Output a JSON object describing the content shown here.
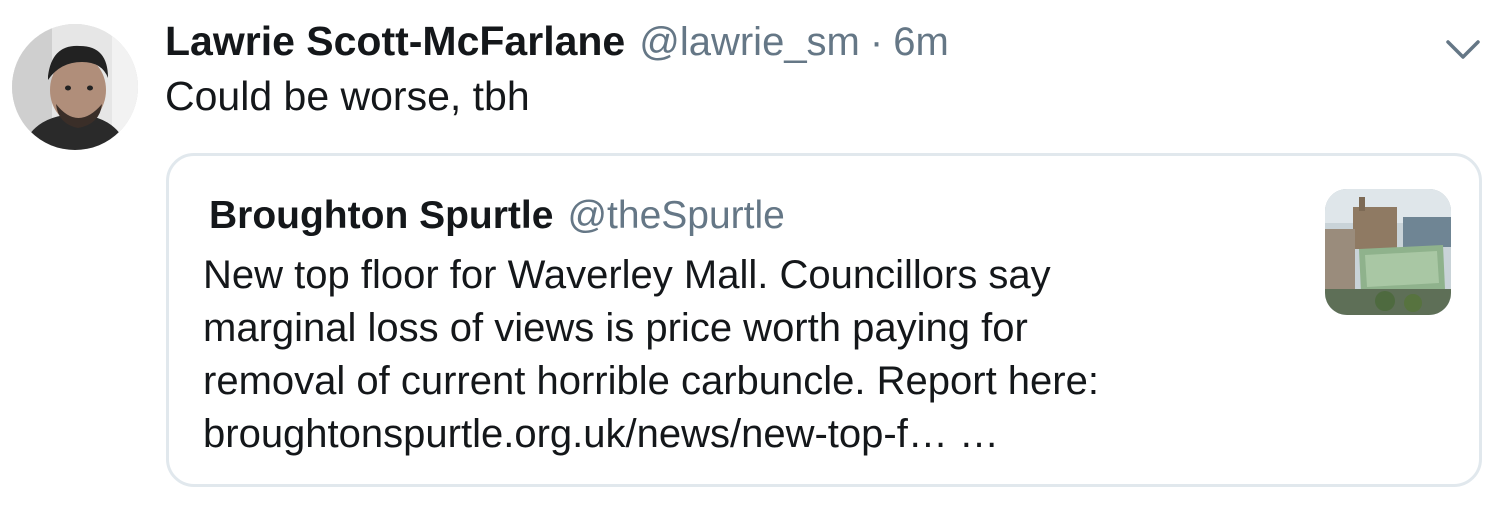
{
  "tweet": {
    "display_name": "Lawrie Scott-McFarlane",
    "handle": "@lawrie_sm",
    "separator": "·",
    "time": "6m",
    "text": "Could be worse, tbh",
    "avatar_icon": "user-avatar",
    "menu_icon": "chevron-down-icon"
  },
  "quoted": {
    "display_name": "Broughton Spurtle",
    "handle": "@theSpurtle",
    "text_lines": [
      "New top floor for Waverley Mall. Councillors say",
      "marginal loss of views is price worth paying for",
      "removal of current horrible carbuncle. Report here:",
      "broughtonspurtle.org.uk/news/new-top-f… …"
    ],
    "thumbnail_icon": "link-preview-thumbnail"
  },
  "colors": {
    "text_primary": "#14171a",
    "text_secondary": "#657786",
    "border": "#e1e8ed",
    "background": "#ffffff"
  }
}
